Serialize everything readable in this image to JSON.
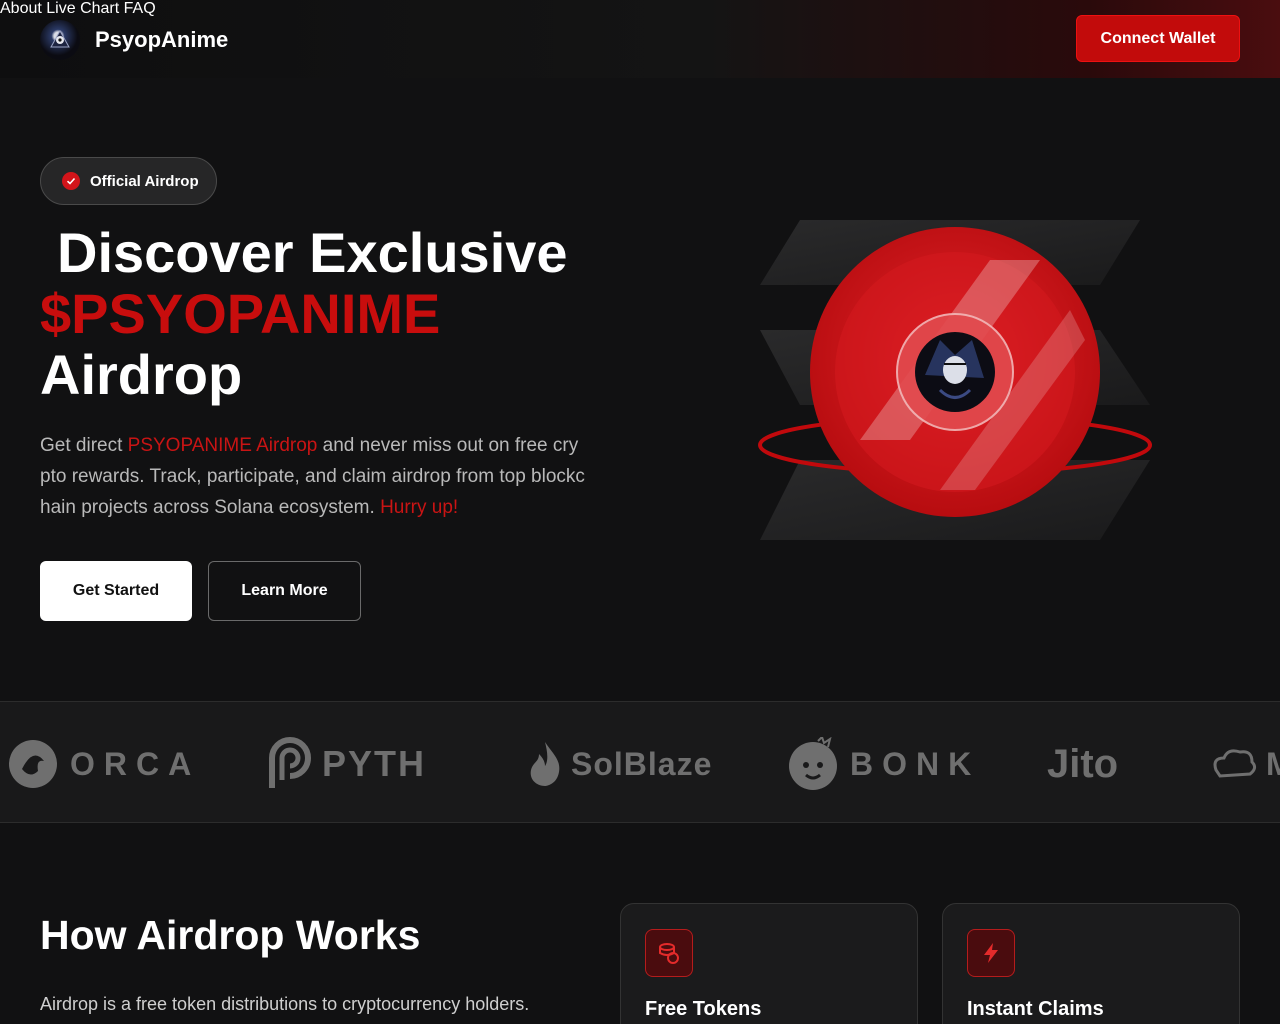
{
  "header": {
    "brand": "PsyopAnime",
    "nav": [
      "About",
      "Live Chart",
      "FAQ"
    ],
    "connect_label": "Connect Wallet"
  },
  "hero": {
    "badge": "Official Airdrop",
    "title_line1": "Discover Exclusive",
    "title_line2": "$PSYOPANIME",
    "title_line3": "Airdrop",
    "desc_pre": "Get direct ",
    "desc_highlight": "PSYOPANIME Airdrop",
    "desc_mid": "  and never miss out on free crypto rewards. Track, participate, and claim airdrop from top blockchain projects across Solana ecosystem. ",
    "desc_hurry": "Hurry up!",
    "primary_label": "Get Started",
    "secondary_label": "Learn More"
  },
  "partners": [
    "ORCA",
    "PYTH",
    "SolBlaze",
    "BONK",
    "Jito",
    "M"
  ],
  "how": {
    "title": "How Airdrop Works",
    "desc": "Airdrop is a free token distributions to cryptocurrency holders.",
    "cards": [
      {
        "title": "Free Tokens",
        "icon": "coins-icon"
      },
      {
        "title": "Instant Claims",
        "icon": "lightning-icon"
      }
    ]
  },
  "colors": {
    "accent": "#c20b0b",
    "background": "#111112",
    "muted_text": "#b9b9b9"
  }
}
